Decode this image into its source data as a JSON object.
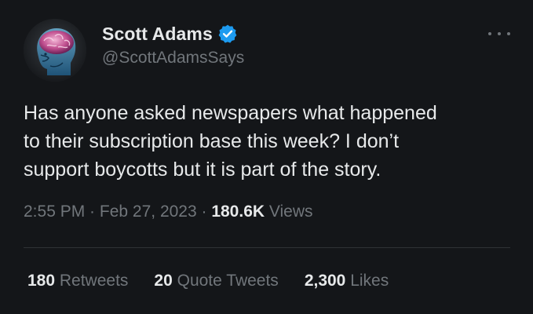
{
  "author": {
    "name": "Scott Adams",
    "handle": "@ScottAdamsSays",
    "verified_color": "#1d9bf0"
  },
  "tweet": {
    "text": "Has anyone asked newspapers what happened\nto their subscription base this week? I don’t\nsupport boycotts but it is part of the story.",
    "time": "2:55 PM",
    "sep1": " · ",
    "date": "Feb 27, 2023",
    "sep2": " · ",
    "views_count": "180.6K",
    "views_label": " Views"
  },
  "stats": {
    "retweets_count": "180",
    "retweets_label": " Retweets",
    "quotes_count": "20",
    "quotes_label": " Quote Tweets",
    "likes_count": "2,300",
    "likes_label": " Likes"
  },
  "icons": {
    "more": "more-icon",
    "verified": "verified-badge-icon"
  },
  "colors": {
    "background": "#141619",
    "text_primary": "#e7e9ea",
    "text_secondary": "#71767b",
    "divider": "#2f3336"
  }
}
